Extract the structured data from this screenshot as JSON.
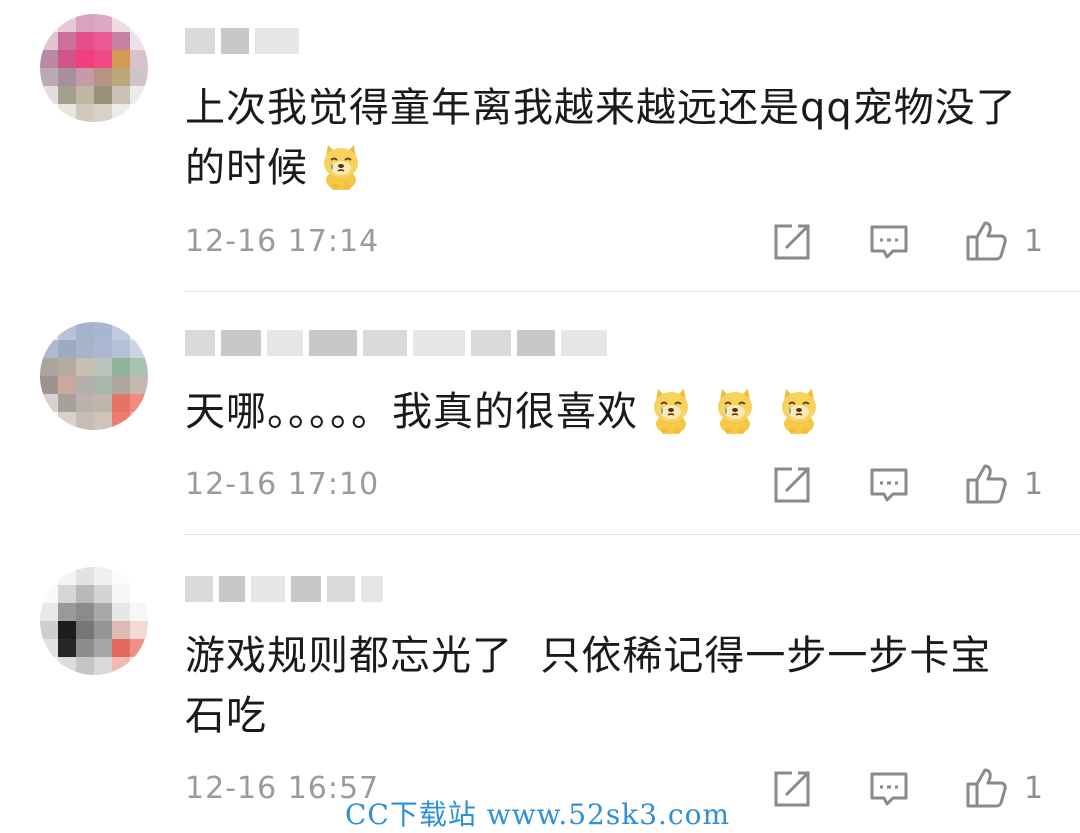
{
  "comments": [
    {
      "text": "上次我觉得童年离我越来越远还是qq宠物没了的时候",
      "emoji_count": 1,
      "timestamp": "12-16 17:14",
      "like_count": "1",
      "emoji_icon": "crying-doge-icon"
    },
    {
      "text": "天哪。。。。。我真的很喜欢",
      "emoji_count": 3,
      "timestamp": "12-16 17:10",
      "like_count": "1",
      "emoji_icon": "crying-doge-icon"
    },
    {
      "text": "游戏规则都忘光了  只依稀记得一步一步卡宝石吃",
      "emoji_count": 0,
      "timestamp": "12-16 16:57",
      "like_count": "1"
    }
  ],
  "watermark": "CC下载站 www.52sk3.com",
  "icons": {
    "share": "share-icon",
    "comment": "comment-icon",
    "like": "thumbs-up-icon"
  },
  "colors": {
    "text": "#1a1a1a",
    "meta": "#9b9b9b",
    "divider": "#e2e2e2",
    "watermark": "#2f8fd8"
  }
}
